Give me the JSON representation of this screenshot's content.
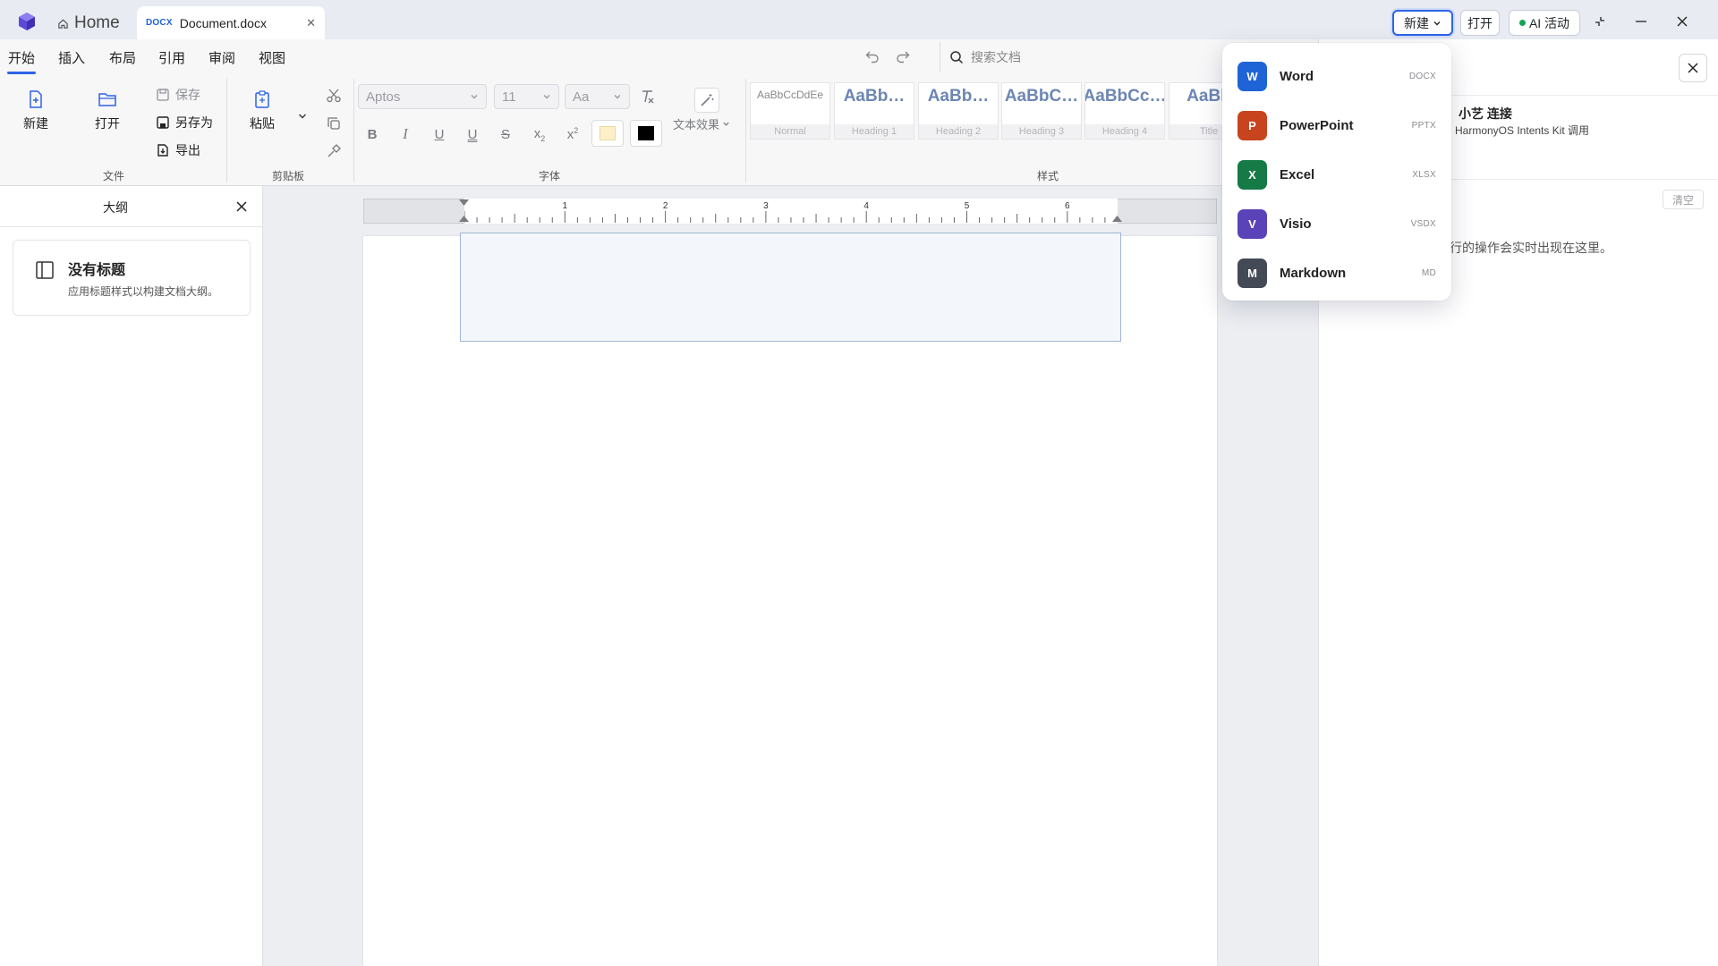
{
  "titlebar": {
    "home_label": "Home",
    "doc_tab": {
      "ext": "DOCX",
      "name": "Document.docx"
    },
    "new_label": "新建",
    "open_label": "打开",
    "ai_label": "AI 活动"
  },
  "ribbon": {
    "tabs": [
      "开始",
      "插入",
      "布局",
      "引用",
      "审阅",
      "视图"
    ],
    "search_placeholder": "搜索文档",
    "file_group": {
      "label": "文件",
      "new": "新建",
      "open": "打开",
      "save": "保存",
      "save_as": "另存为",
      "export": "导出"
    },
    "clipboard_group": {
      "label": "剪贴板",
      "paste": "粘贴"
    },
    "font_group": {
      "label": "字体",
      "font_name": "Aptos",
      "font_size": "11",
      "case": "Aa",
      "text_effects": "文本效果"
    },
    "styles_group": {
      "label": "样式",
      "styles": [
        {
          "sample": "AaBbCcDdEe",
          "name": "Normal"
        },
        {
          "sample": "AaBb…",
          "name": "Heading 1"
        },
        {
          "sample": "AaBb…",
          "name": "Heading 2"
        },
        {
          "sample": "AaBbC…",
          "name": "Heading 3"
        },
        {
          "sample": "AaBbCc…",
          "name": "Heading 4"
        },
        {
          "sample": "AaBb",
          "name": "Title"
        }
      ]
    }
  },
  "outline": {
    "title": "大纲",
    "empty_title": "没有标题",
    "empty_desc": "应用标题样式以构建文档大纲。"
  },
  "ruler": {
    "ticks": [
      "1",
      "2",
      "3",
      "4",
      "5",
      "6"
    ]
  },
  "right_panel": {
    "title": "小艺 连接",
    "subtitle": "HarmonyOS Intents Kit 调用",
    "clear": "清空",
    "empty_text": "行的操作会实时出现在这里。"
  },
  "new_menu": {
    "items": [
      {
        "label": "Word",
        "ext": "DOCX",
        "letter": "W",
        "color": "#1f64d6"
      },
      {
        "label": "PowerPoint",
        "ext": "PPTX",
        "letter": "P",
        "color": "#c8441f"
      },
      {
        "label": "Excel",
        "ext": "XLSX",
        "letter": "X",
        "color": "#157a45"
      },
      {
        "label": "Visio",
        "ext": "VSDX",
        "letter": "V",
        "color": "#5a43b8"
      },
      {
        "label": "Markdown",
        "ext": "MD",
        "letter": "M",
        "color": "#444a55"
      }
    ]
  },
  "colors": {
    "accent": "#2e64e6",
    "highlight_swatch": "#fdf0c8",
    "font_color_swatch": "#000000"
  }
}
